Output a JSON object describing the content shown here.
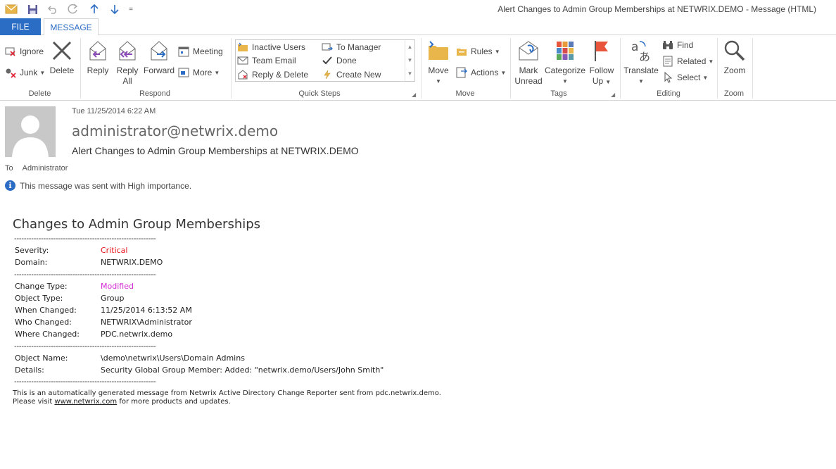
{
  "window": {
    "title": "Alert Changes to Admin Group Memberships at NETWRIX.DEMO - Message (HTML)"
  },
  "quick_access": {
    "overflow_label": "="
  },
  "tabs": [
    {
      "label": "FILE"
    },
    {
      "label": "MESSAGE"
    }
  ],
  "ribbon": {
    "delete_group": {
      "label": "Delete",
      "ignore": "Ignore",
      "junk": "Junk",
      "delete": "Delete"
    },
    "respond_group": {
      "label": "Respond",
      "reply": "Reply",
      "reply_all_1": "Reply",
      "reply_all_2": "All",
      "forward": "Forward",
      "meeting": "Meeting",
      "more": "More"
    },
    "quick_steps_group": {
      "label": "Quick Steps",
      "items": [
        "Inactive Users",
        "Team Email",
        "Reply & Delete",
        "To Manager",
        "Done",
        "Create New"
      ]
    },
    "move_group": {
      "label": "Move",
      "move": "Move",
      "rules": "Rules",
      "actions": "Actions"
    },
    "tags_group": {
      "label": "Tags",
      "mark_unread_1": "Mark",
      "mark_unread_2": "Unread",
      "categorize": "Categorize",
      "follow_up_1": "Follow",
      "follow_up_2": "Up"
    },
    "editing_group": {
      "label": "Editing",
      "translate": "Translate",
      "find": "Find",
      "related": "Related",
      "select": "Select"
    },
    "zoom_group": {
      "label": "Zoom",
      "zoom": "Zoom"
    }
  },
  "header": {
    "date": "Tue 11/25/2014 6:22 AM",
    "sender": "administrator@netwrix.demo",
    "subject": "Alert Changes to Admin Group Memberships at NETWRIX.DEMO",
    "to_label": "To",
    "to_value": "Administrator",
    "importance": "This message was sent with High importance."
  },
  "body": {
    "heading": "Changes to Admin Group Memberships",
    "divider": "--------------------------------------------------------------------",
    "severity_label": "Severity:",
    "severity_value": "Critical",
    "domain_label": "Domain:",
    "domain_value": "NETWRIX.DEMO",
    "change_type_label": "Change Type:",
    "change_type_value": "Modified",
    "object_type_label": "Object Type:",
    "object_type_value": "Group",
    "when_changed_label": "When Changed:",
    "when_changed_value": "11/25/2014 6:13:52 AM",
    "who_changed_label": "Who Changed:",
    "who_changed_value": "NETWRIX\\Administrator",
    "where_changed_label": "Where Changed:",
    "where_changed_value": "PDC.netwrix.demo",
    "object_name_label": "Object Name:",
    "object_name_value": "\\demo\\netwrix\\Users\\Domain Admins",
    "details_label": "Details:",
    "details_value": "Security Global Group Member: Added: \"netwrix.demo/Users/John Smith\"",
    "footer_1": "This is an automatically generated message from Netwrix Active Directory Change Reporter sent from pdc.netwrix.demo.",
    "footer_2_pre": "Please visit ",
    "footer_2_link": "www.netwrix.com",
    "footer_2_post": " for more products and updates."
  },
  "colors": {
    "accent": "#2b6cc4",
    "critical": "#e8141a",
    "modified": "#d42bd4"
  }
}
